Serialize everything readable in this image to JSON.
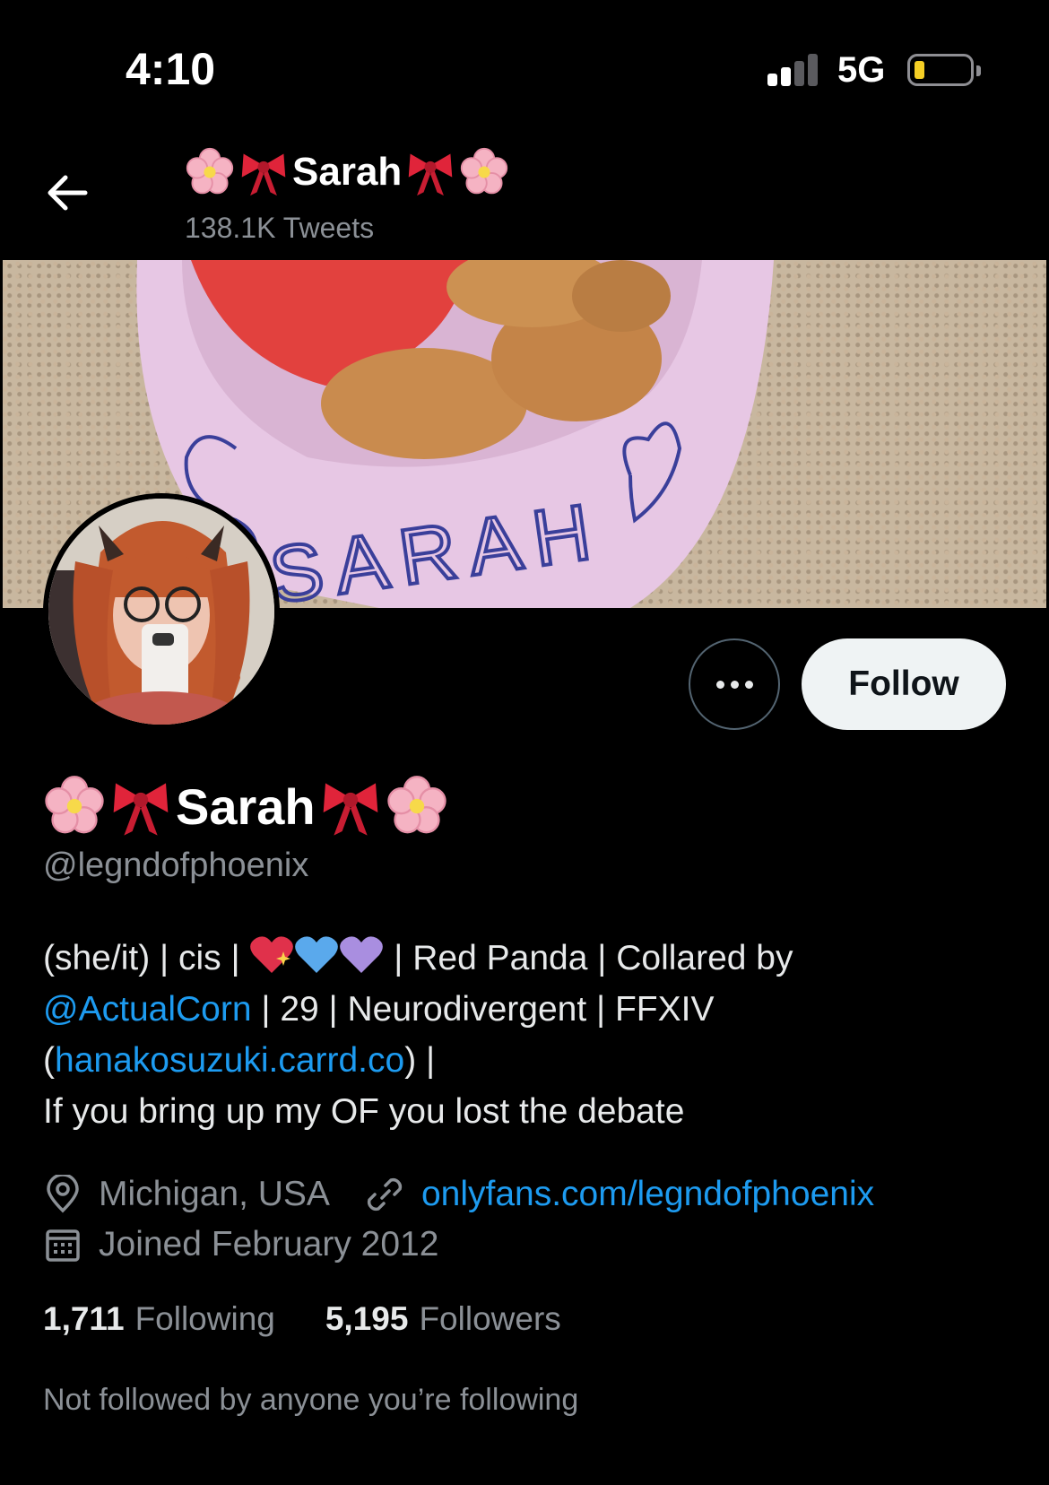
{
  "status_bar": {
    "time": "4:10",
    "network": "5G",
    "signal_bars_active": 2,
    "battery_level": 0.12
  },
  "header": {
    "display_name": "Sarah",
    "tweet_count": "138.1K Tweets",
    "name_decorations": [
      "cherry-blossom-icon",
      "ribbon-icon",
      "ribbon-icon",
      "cherry-blossom-icon"
    ]
  },
  "banner": {
    "bowl_text": "SARAH"
  },
  "actions": {
    "follow_label": "Follow"
  },
  "profile": {
    "display_name": "Sarah",
    "handle": "@legndofphoenix",
    "bio": {
      "line1_a": "(she/it) | cis | ",
      "line1_b": " | Red Panda | Collared by",
      "mention": "@ActualCorn",
      "line2_rest": " | 29 | Neurodivergent | FFXIV",
      "paren_open": "(",
      "carrd_link": "hanakosuzuki.carrd.co",
      "paren_close": ") |",
      "line4": "If you bring up my OF you lost the debate",
      "hearts": [
        "sparkling-heart-icon",
        "blue-heart-icon",
        "purple-heart-icon"
      ]
    },
    "location": "Michigan, USA",
    "website": "onlyfans.com/legndofphoenix",
    "joined": "Joined February 2012",
    "following_count": "1,711",
    "following_label": "Following",
    "followers_count": "5,195",
    "followers_label": "Followers",
    "not_followed_text": "Not followed by anyone you’re following"
  },
  "colors": {
    "background": "#000000",
    "link": "#1d9bf0",
    "secondary_text": "#8b9096",
    "follow_button_bg": "#eff3f4"
  }
}
